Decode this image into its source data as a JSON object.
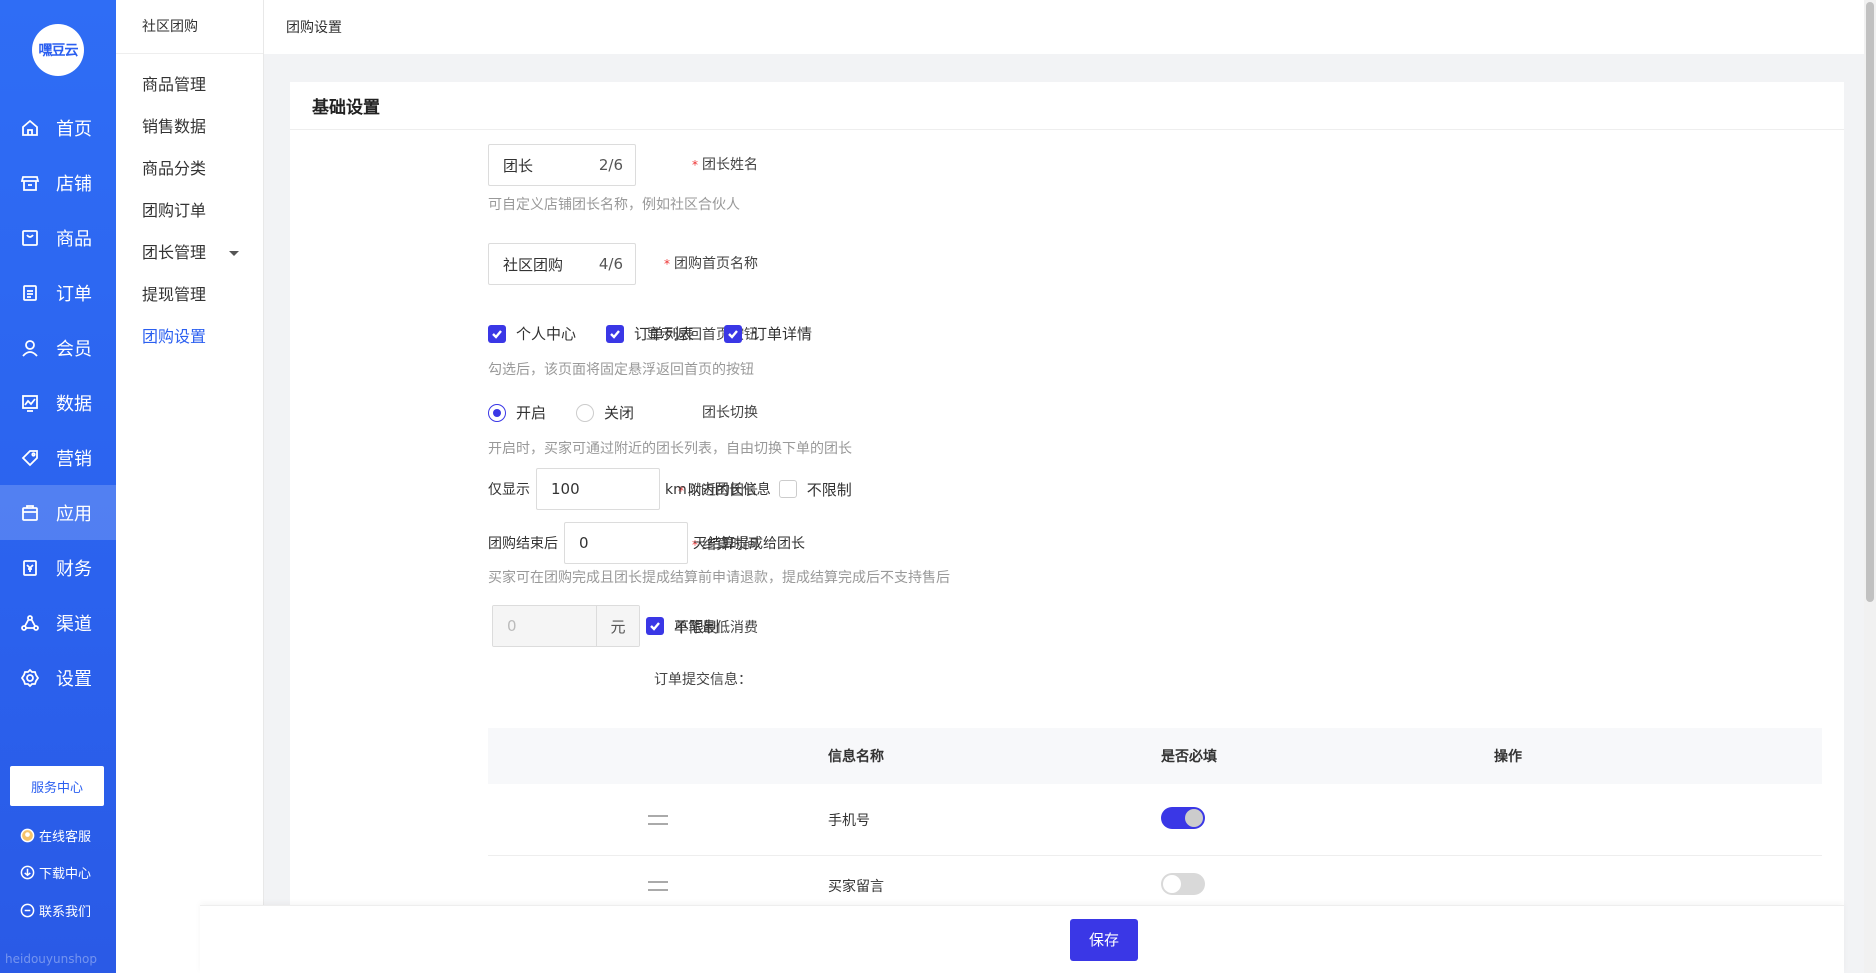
{
  "brand": {
    "logo_text": "嘿豆云",
    "watermark": "heidouyunshop"
  },
  "sidebar": {
    "items": [
      {
        "label": "首页",
        "icon": "home-icon"
      },
      {
        "label": "店铺",
        "icon": "store-icon"
      },
      {
        "label": "商品",
        "icon": "goods-icon"
      },
      {
        "label": "订单",
        "icon": "order-icon"
      },
      {
        "label": "会员",
        "icon": "member-icon"
      },
      {
        "label": "数据",
        "icon": "chart-icon"
      },
      {
        "label": "营销",
        "icon": "tag-icon"
      },
      {
        "label": "应用",
        "icon": "app-icon",
        "active": true
      },
      {
        "label": "财务",
        "icon": "finance-icon"
      },
      {
        "label": "渠道",
        "icon": "channel-icon"
      },
      {
        "label": "设置",
        "icon": "settings-icon"
      }
    ],
    "service_center": "服务中心",
    "online_service": "在线客服",
    "download_center": "下载中心",
    "contact_us": "联系我们"
  },
  "subnav": {
    "title": "社区团购",
    "items": [
      {
        "label": "商品管理"
      },
      {
        "label": "销售数据"
      },
      {
        "label": "商品分类"
      },
      {
        "label": "团购订单"
      },
      {
        "label": "团长管理",
        "has_caret": true
      },
      {
        "label": "提现管理"
      },
      {
        "label": "团购设置",
        "active": true
      }
    ]
  },
  "header": {
    "breadcrumb": "团购设置"
  },
  "card": {
    "title": "基础设置"
  },
  "form": {
    "leader_name": {
      "label": "团长姓名",
      "value": "团长",
      "count": "2/6",
      "hint": "可自定义店铺团长名称，例如社区合伙人"
    },
    "home_name": {
      "label": "团购首页名称",
      "value": "社区团购",
      "count": "4/6"
    },
    "back_button": {
      "label": "显示返回首页按钮",
      "options": [
        "个人中心",
        "订单列表",
        "订单详情"
      ],
      "hint": "勾选后，该页面将固定悬浮返回首页的按钮"
    },
    "leader_switch": {
      "label": "团长切换",
      "on_label": "开启",
      "off_label": "关闭",
      "hint": "开启时，买家可通过附近的团长列表，自由切换下单的团长"
    },
    "nearby": {
      "label": "附近的团长",
      "prefix": "仅显示",
      "value": "100",
      "suffix": "km以内团长信息",
      "unlimited": "不限制"
    },
    "settle": {
      "label": "结算时间",
      "prefix": "团购结束后",
      "value": "0",
      "suffix": "天结算提成给团长",
      "hint": "买家可在团购完成且团长提成结算前申请退款，提成结算完成后不支持售后"
    },
    "min_spend": {
      "label": "单笔最低消费",
      "value": "0",
      "unit": "元",
      "unlimited": "不限制"
    },
    "order_info": {
      "label": "订单提交信息："
    }
  },
  "table": {
    "headers": [
      "信息名称",
      "是否必填",
      "操作"
    ],
    "rows": [
      {
        "name": "手机号",
        "required": true
      },
      {
        "name": "买家留言",
        "required": false
      }
    ]
  },
  "footer": {
    "save_label": "保存"
  },
  "colors": {
    "primary": "#3a37e6",
    "sidebar": "#2b62ee",
    "required_star": "#e33333"
  }
}
